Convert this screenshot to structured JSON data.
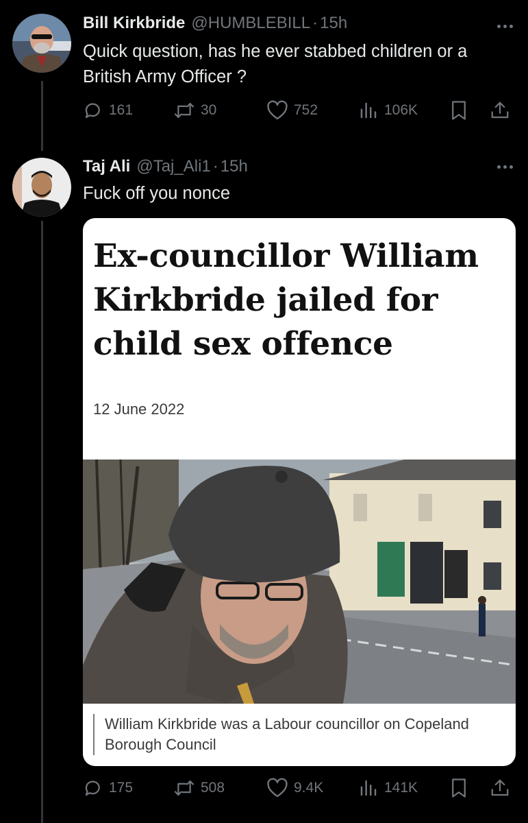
{
  "thread": {
    "tweet1": {
      "name": "Bill Kirkbride",
      "handle": "@HUMBLEBILL",
      "time": "15h",
      "text": "Quick question,  has he ever stabbed children or a British Army Officer ?",
      "replies": "161",
      "retweets": "30",
      "likes": "752",
      "views": "106K"
    },
    "tweet2": {
      "name": "Taj Ali",
      "handle": "@Taj_Ali1",
      "time": "15h",
      "text": "Fuck off you nonce",
      "replies": "175",
      "retweets": "508",
      "likes": "9.4K",
      "views": "141K",
      "card": {
        "headline": "Ex-councillor William Kirkbride jailed for child sex offence",
        "date": "12 June 2022",
        "caption": "William Kirkbride was a Labour councillor on Copeland Borough Council"
      }
    }
  },
  "icons": {
    "reply": "reply-icon",
    "retweet": "retweet-icon",
    "like": "heart-icon",
    "views": "views-chart-icon",
    "bookmark": "bookmark-icon",
    "share": "share-icon",
    "more": "more-dots-icon"
  },
  "colors": {
    "background": "#000000",
    "primary_text": "#e7e9ea",
    "secondary_text": "#71767b",
    "thread_line": "#333639",
    "card_background": "#ffffff"
  }
}
